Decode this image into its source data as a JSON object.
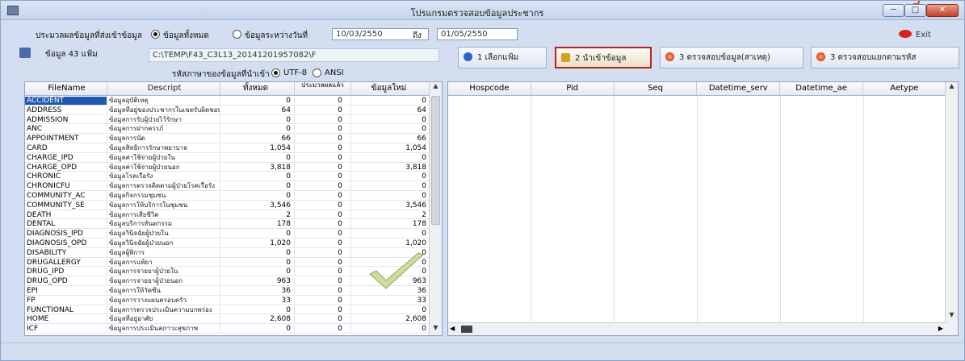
{
  "window": {
    "title": "โปรแกรมตรวจสอบข้อมูลประชากร",
    "min": "─",
    "max": "□",
    "close": "✕"
  },
  "filter": {
    "label": "ประมวลผลข้อมูลที่ส่งเข้าข้อมูล",
    "radio_all": "ข้อมูลทั้งหมด",
    "radio_range": "ข้อมูลระหว่างวันที่",
    "date_from": "10/03/2550",
    "to_label": "ถึง",
    "date_to": "01/05/2550"
  },
  "exit_label": "Exit",
  "source": {
    "count_label": "ข้อมูล 43 แฟ้ม",
    "path": "C:\\TEMP\\F43_C3L13_20141201957082\\F"
  },
  "encoding": {
    "label": "รหัสภาษาของข้อมูลที่นำเข้า",
    "utf8": "UTF-8",
    "ansi": "ANSI"
  },
  "toolbar": {
    "btn1": "1 เลือกแฟ้ม",
    "btn2": "2 นำเข้าข้อมูล",
    "btn3": "3 ตรวจสอบข้อมูล(สาเหตุ)",
    "btn4": "3 ตรวจสอบแยกตามรหัส"
  },
  "left_table": {
    "columns": [
      "FileName",
      "Descript",
      "ทั้งหมด",
      "ประมวลผลแล้ว",
      "ข้อมูลใหม่"
    ],
    "rows": [
      {
        "file": "ACCIDENT",
        "desc": "ข้อมูลอุบัติเหตุ",
        "total": "0",
        "proc": "0",
        "new": "0"
      },
      {
        "file": "ADDRESS",
        "desc": "ข้อมูลที่อยู่ของประชากรในเขตรับผิดชอบ",
        "total": "64",
        "proc": "0",
        "new": "64"
      },
      {
        "file": "ADMISSION",
        "desc": "ข้อมูลการรับผู้ป่วยไว้รักษา",
        "total": "0",
        "proc": "0",
        "new": "0"
      },
      {
        "file": "ANC",
        "desc": "ข้อมูลการฝากครรภ์",
        "total": "0",
        "proc": "0",
        "new": "0"
      },
      {
        "file": "APPOINTMENT",
        "desc": "ข้อมูลการนัด",
        "total": "66",
        "proc": "0",
        "new": "66"
      },
      {
        "file": "CARD",
        "desc": "ข้อมูลสิทธิการรักษาพยาบาล",
        "total": "1,054",
        "proc": "0",
        "new": "1,054"
      },
      {
        "file": "CHARGE_IPD",
        "desc": "ข้อมูลค่าใช้จ่ายผู้ป่วยใน",
        "total": "0",
        "proc": "0",
        "new": "0"
      },
      {
        "file": "CHARGE_OPD",
        "desc": "ข้อมูลค่าใช้จ่ายผู้ป่วยนอก",
        "total": "3,818",
        "proc": "0",
        "new": "3,818"
      },
      {
        "file": "CHRONIC",
        "desc": "ข้อมูลโรคเรื้อรัง",
        "total": "0",
        "proc": "0",
        "new": "0"
      },
      {
        "file": "CHRONICFU",
        "desc": "ข้อมูลการตรวจติดตามผู้ป่วยโรคเรื้อรัง",
        "total": "0",
        "proc": "0",
        "new": "0"
      },
      {
        "file": "COMMUNITY_AC",
        "desc": "ข้อมูลกิจกรรมชุมชน",
        "total": "0",
        "proc": "0",
        "new": "0"
      },
      {
        "file": "COMMUNITY_SE",
        "desc": "ข้อมูลการให้บริการในชุมชน",
        "total": "3,546",
        "proc": "0",
        "new": "3,546"
      },
      {
        "file": "DEATH",
        "desc": "ข้อมูลการเสียชีวิต",
        "total": "2",
        "proc": "0",
        "new": "2"
      },
      {
        "file": "DENTAL",
        "desc": "ข้อมูลบริการทันตกรรม",
        "total": "178",
        "proc": "0",
        "new": "178"
      },
      {
        "file": "DIAGNOSIS_IPD",
        "desc": "ข้อมูลวินิจฉัยผู้ป่วยใน",
        "total": "0",
        "proc": "0",
        "new": "0"
      },
      {
        "file": "DIAGNOSIS_OPD",
        "desc": "ข้อมูลวินิจฉัยผู้ป่วยนอก",
        "total": "1,020",
        "proc": "0",
        "new": "1,020"
      },
      {
        "file": "DISABILITY",
        "desc": "ข้อมูลผู้พิการ",
        "total": "0",
        "proc": "0",
        "new": "0"
      },
      {
        "file": "DRUGALLERGY",
        "desc": "ข้อมูลการแพ้ยา",
        "total": "0",
        "proc": "0",
        "new": "0"
      },
      {
        "file": "DRUG_IPD",
        "desc": "ข้อมูลการจ่ายยาผู้ป่วยใน",
        "total": "0",
        "proc": "0",
        "new": "0"
      },
      {
        "file": "DRUG_OPD",
        "desc": "ข้อมูลการจ่ายยาผู้ป่วยนอก",
        "total": "963",
        "proc": "0",
        "new": "963"
      },
      {
        "file": "EPI",
        "desc": "ข้อมูลการให้วัคซีน",
        "total": "36",
        "proc": "0",
        "new": "36"
      },
      {
        "file": "FP",
        "desc": "ข้อมูลการวางแผนครอบครัว",
        "total": "33",
        "proc": "0",
        "new": "33"
      },
      {
        "file": "FUNCTIONAL",
        "desc": "ข้อมูลการตรวจประเมินความบกพร่อง",
        "total": "0",
        "proc": "0",
        "new": "0"
      },
      {
        "file": "HOME",
        "desc": "ข้อมูลที่อยู่อาศัย",
        "total": "2,608",
        "proc": "0",
        "new": "2,608"
      },
      {
        "file": "ICF",
        "desc": "ข้อมูลการประเมินสภาวะสุขภาพ",
        "total": "0",
        "proc": "0",
        "new": "0"
      }
    ]
  },
  "right_table": {
    "columns": [
      "Hospcode",
      "Pid",
      "Seq",
      "Datetime_serv",
      "Datetime_ae",
      "Aetype"
    ]
  },
  "colors": {
    "selected_row": "#2058b0",
    "selected_button_border": "#b62224",
    "exit_icon": "#d82418"
  },
  "icons": {
    "app": "app-icon",
    "db": "database-icon",
    "check": "checkmark-icon"
  }
}
